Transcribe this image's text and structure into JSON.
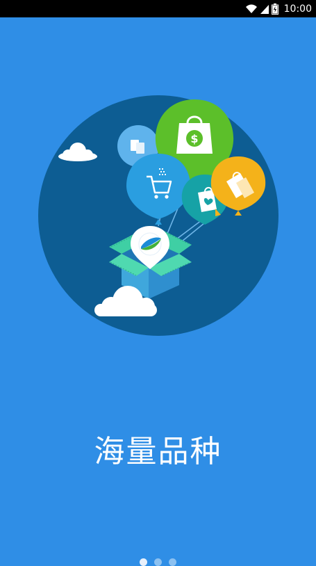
{
  "status_bar": {
    "time": "10:00",
    "icons": [
      "wifi-icon",
      "signal-icon",
      "battery-icon"
    ]
  },
  "onboarding": {
    "headline": "海量品种",
    "illustration_icons": [
      "cloud-icon",
      "shopping-bag-icon",
      "dollar-bag-icon",
      "shopping-cart-icon",
      "heart-bag-icon",
      "gift-bag-icon",
      "app-logo-icon",
      "open-box-icon"
    ],
    "pager": {
      "page_count": 3,
      "active_index": 0
    }
  },
  "colors": {
    "background": "#2f8ee6",
    "circle": "#0d5d93",
    "green_balloon": "#5cbf2a",
    "blue_balloon": "#2a9ee0",
    "teal_balloon": "#16a2a6",
    "yellow_balloon": "#f4b21a",
    "light_balloon": "#5fb3ec",
    "box": "#3fa7dc",
    "box_lid": "#3fcfa4"
  }
}
